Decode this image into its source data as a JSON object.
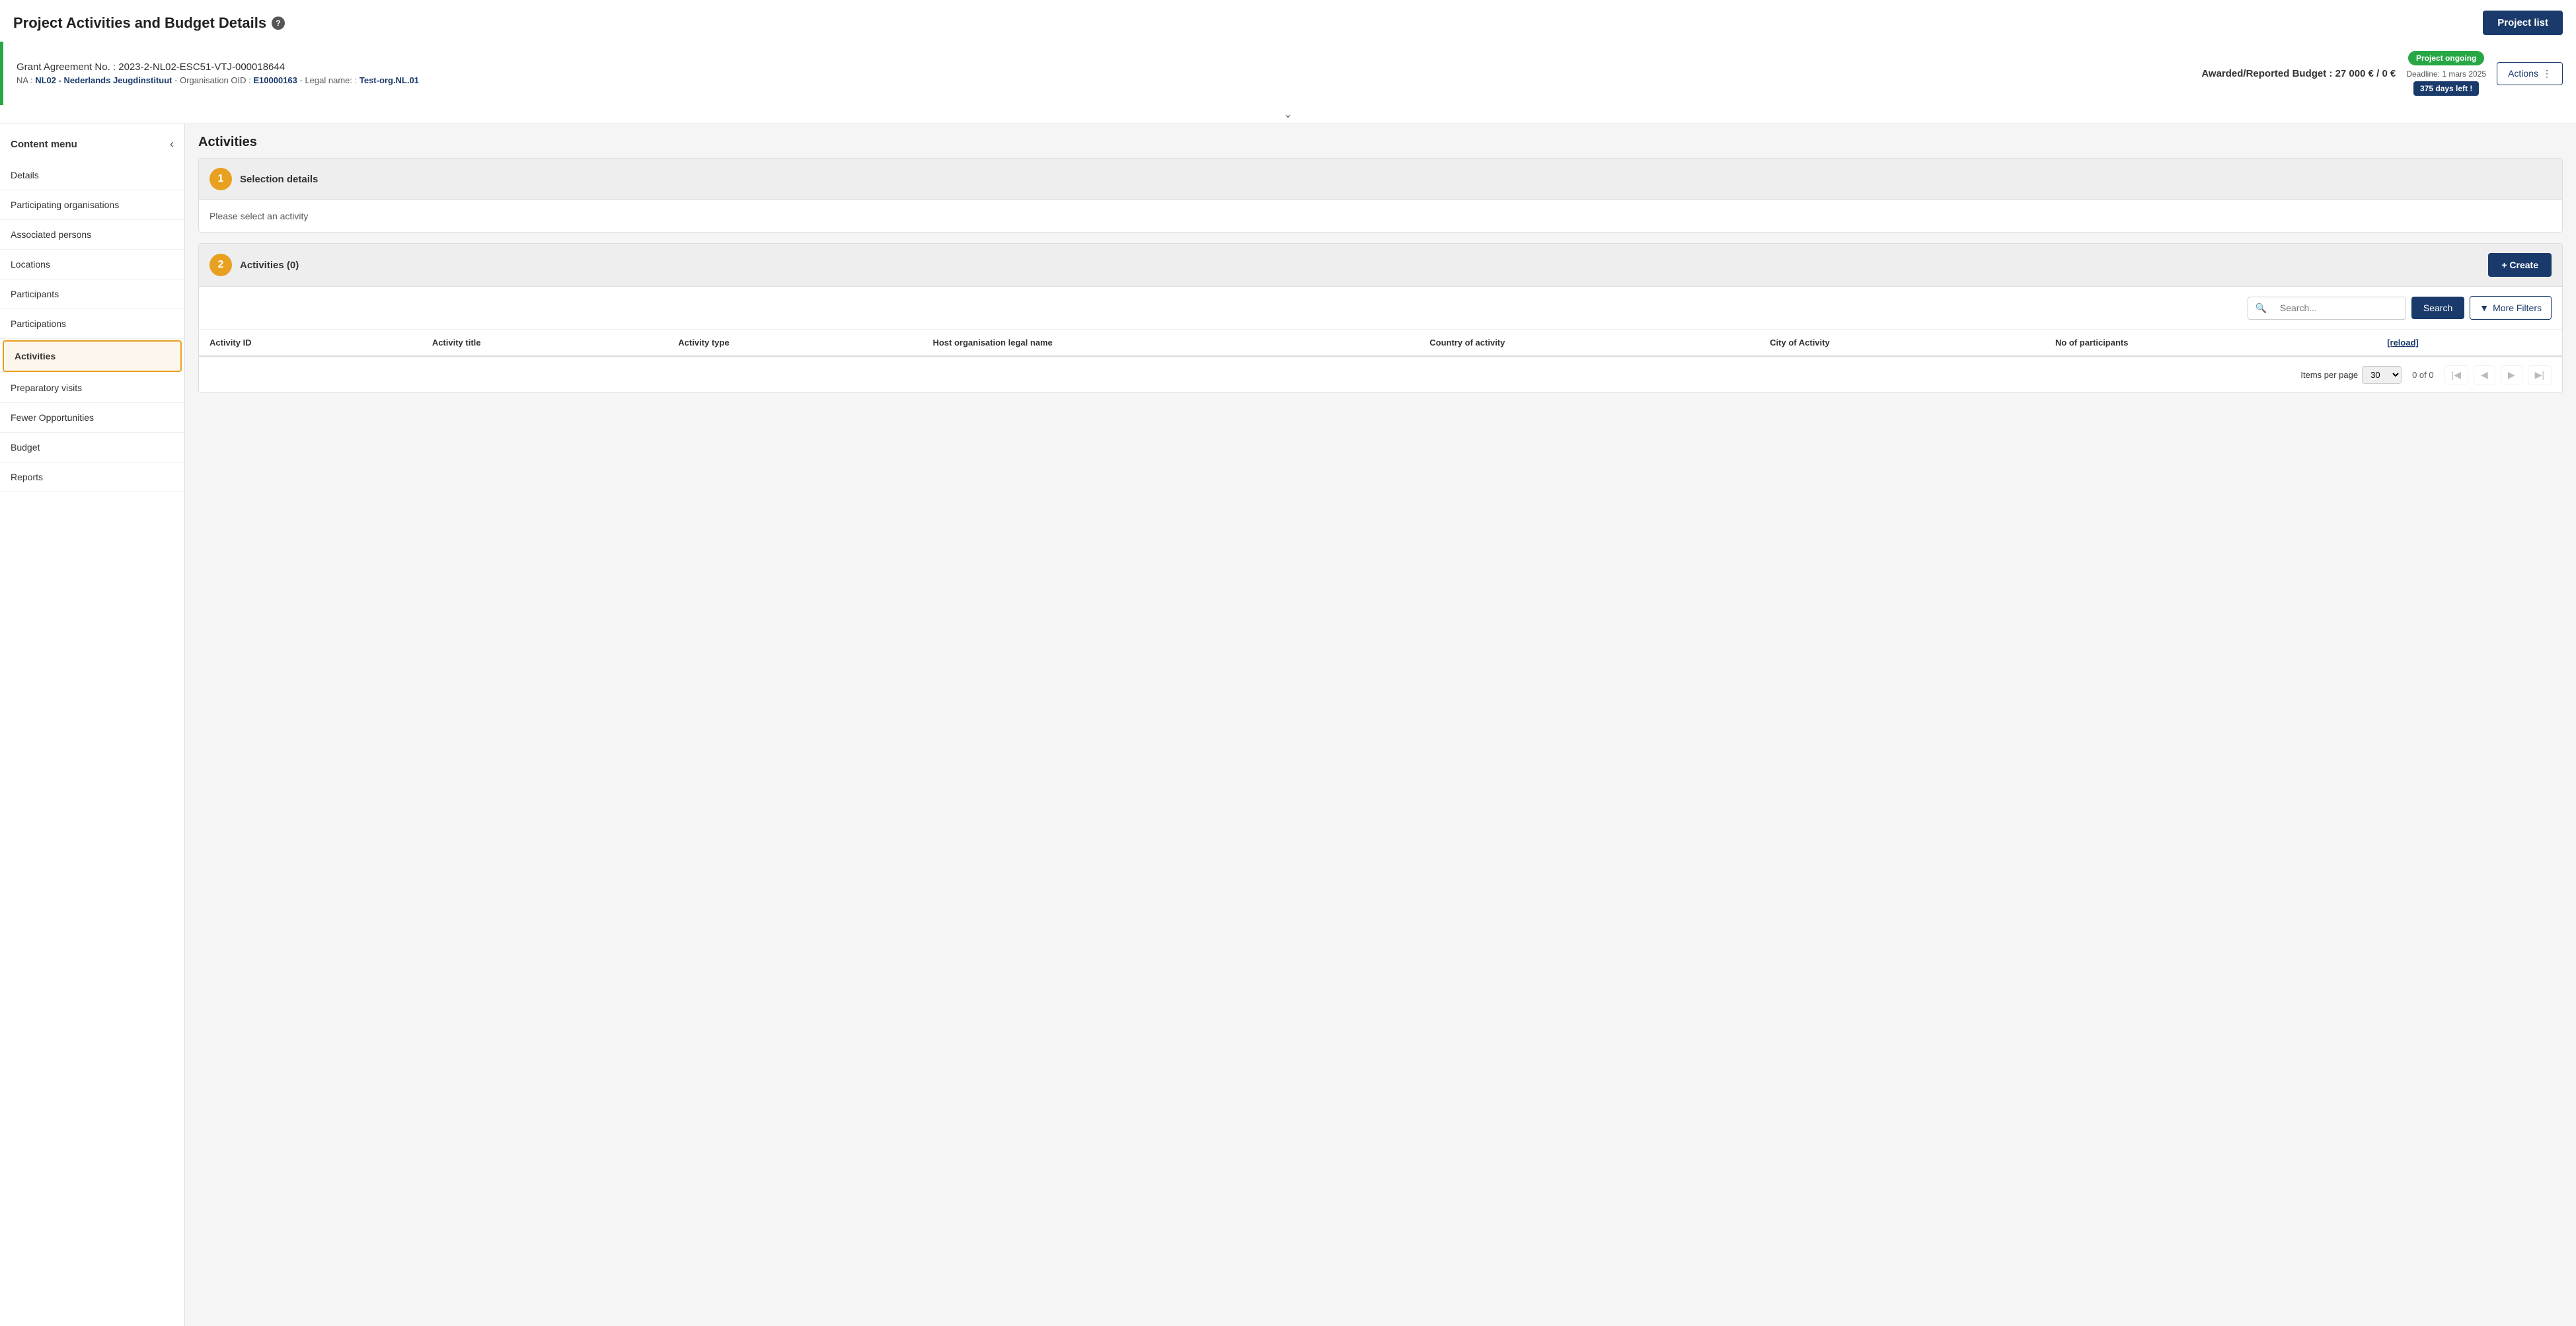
{
  "header": {
    "title": "Project Activities and Budget Details",
    "info_icon": "?",
    "project_list_btn": "Project list"
  },
  "grant_bar": {
    "grant_label": "Grant Agreement No. :",
    "grant_no": "2023-2-NL02-ESC51-VTJ-000018644",
    "awarded_label": "Awarded/Reported Budget : 27 000 € / 0 €",
    "na_prefix": "NA :",
    "na_name": "NL02 - Nederlands Jeugdinstituut",
    "org_oid_label": "- Organisation OID :",
    "org_oid": "E10000163",
    "legal_label": "- Legal name: :",
    "legal_name": "Test-org.NL.01",
    "status": "Project ongoing",
    "deadline_label": "Deadline: 1 mars 2025",
    "days_left": "375 days left !",
    "actions_btn": "Actions"
  },
  "sidebar": {
    "title": "Content menu",
    "close_icon": "‹",
    "items": [
      {
        "id": "details",
        "label": "Details",
        "active": false
      },
      {
        "id": "participating-organisations",
        "label": "Participating organisations",
        "active": false
      },
      {
        "id": "associated-persons",
        "label": "Associated persons",
        "active": false
      },
      {
        "id": "locations",
        "label": "Locations",
        "active": false
      },
      {
        "id": "participants",
        "label": "Participants",
        "active": false
      },
      {
        "id": "participations",
        "label": "Participations",
        "active": false
      },
      {
        "id": "activities",
        "label": "Activities",
        "active": true
      },
      {
        "id": "preparatory-visits",
        "label": "Preparatory visits",
        "active": false
      },
      {
        "id": "fewer-opportunities",
        "label": "Fewer Opportunities",
        "active": false
      },
      {
        "id": "budget",
        "label": "Budget",
        "active": false
      },
      {
        "id": "reports",
        "label": "Reports",
        "active": false
      }
    ]
  },
  "main": {
    "section_title": "Activities",
    "selection_details": {
      "step": "1",
      "title": "Selection details",
      "body": "Please select an activity"
    },
    "activities_section": {
      "step": "2",
      "title": "Activities (0)",
      "create_btn": "+ Create"
    },
    "search": {
      "placeholder": "Search...",
      "search_btn": "Search",
      "more_filters_btn": "More Filters",
      "filter_icon": "▼"
    },
    "table": {
      "columns": [
        "Activity ID",
        "Activity title",
        "Activity type",
        "Host organisation legal name",
        "Country of activity",
        "City of Activity",
        "No of participants",
        "[reload]"
      ],
      "rows": []
    },
    "pagination": {
      "items_per_page_label": "Items per page",
      "per_page": "30",
      "page_info": "0 of 0",
      "first_btn": "|◀",
      "prev_btn": "◀",
      "next_btn": "▶",
      "last_btn": "▶|"
    }
  }
}
